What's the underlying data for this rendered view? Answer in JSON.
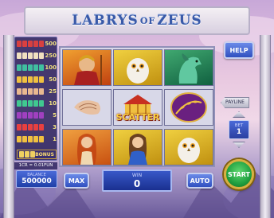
{
  "game": {
    "title_part1": "LABRYS",
    "title_part2": "OF",
    "title_part3": "ZEUS"
  },
  "paytable": [
    {
      "icon_color": "#d84040",
      "value": "500"
    },
    {
      "icon_color": "#f0e0c0",
      "value": "250"
    },
    {
      "icon_color": "#40c0a0",
      "value": "100"
    },
    {
      "icon_color": "#f0c040",
      "value": "50"
    },
    {
      "icon_color": "#e8b890",
      "value": "25"
    },
    {
      "icon_color": "#40c890",
      "value": "10"
    },
    {
      "icon_color": "#a040c0",
      "value": "5"
    },
    {
      "icon_color": "#e84040",
      "value": "3"
    },
    {
      "icon_color": "#f0c040",
      "value": "1"
    }
  ],
  "bonus": {
    "label": "BONUS"
  },
  "coin_info": "1CR = 0.01FUN",
  "reels": [
    {
      "symbol": "warrior",
      "label": ""
    },
    {
      "symbol": "owl",
      "label": ""
    },
    {
      "symbol": "horse",
      "label": ""
    },
    {
      "symbol": "shell",
      "label": ""
    },
    {
      "symbol": "scatter",
      "label": "SCATTER"
    },
    {
      "symbol": "laurel",
      "label": ""
    },
    {
      "symbol": "goddess-red",
      "label": ""
    },
    {
      "symbol": "goddess-blue",
      "label": ""
    },
    {
      "symbol": "owl",
      "label": ""
    }
  ],
  "controls": {
    "help": "HELP",
    "payline": "PAYLINE",
    "bet_label": "BET",
    "bet_value": "1",
    "start": "START",
    "max": "MAX",
    "auto": "AUTO"
  },
  "balance": {
    "label": "BALANCE",
    "value": "500000"
  },
  "win": {
    "label": "WIN",
    "value": "0"
  }
}
